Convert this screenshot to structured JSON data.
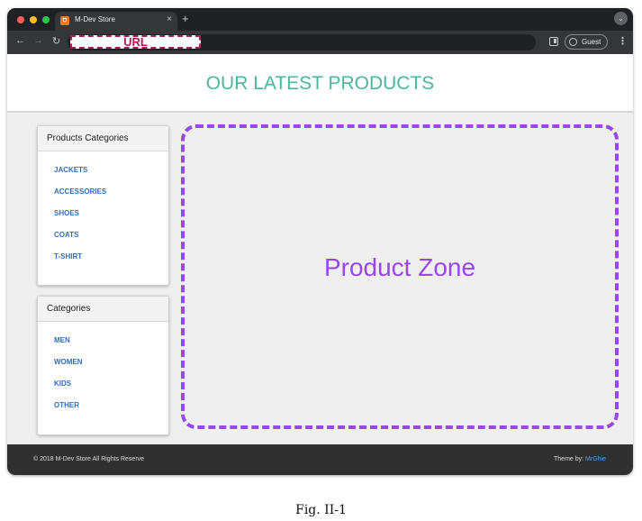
{
  "browser": {
    "tab_title": "M-Dev Store",
    "tab_close": "×",
    "new_tab": "+",
    "tab_menu": "⌄",
    "back": "←",
    "forward": "→",
    "reload": "↻",
    "url_label": "URL",
    "profile_label": "Guest",
    "menu": "⋮"
  },
  "header": {
    "title": "OUR LATEST PRODUCTS"
  },
  "product_categories": {
    "title": "Products Categories",
    "items": [
      "JACKETS",
      "ACCESSORIES",
      "SHOES",
      "COATS",
      "T-SHIRT"
    ]
  },
  "categories": {
    "title": "Categories",
    "items": [
      "MEN",
      "WOMEN",
      "KIDS",
      "OTHER"
    ]
  },
  "product_zone": {
    "label": "Product Zone"
  },
  "footer": {
    "copyright": "© 2018 M-Dev Store All Rights Reserve",
    "theme_by": "Theme by:",
    "theme_author": "MrGhie"
  },
  "caption": "Fig. II-1",
  "colors": {
    "accent_title": "#48b89f",
    "product_zone": "#9747ea",
    "url_marker": "#a51d5b",
    "link": "#2f6fb4"
  }
}
